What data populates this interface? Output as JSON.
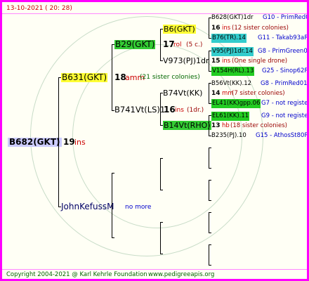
{
  "header": {
    "date": "13-10-2021 ( 20: 28)"
  },
  "root": {
    "name": "B682(GKT)",
    "count": "19",
    "unit": "ins"
  },
  "father": {
    "name": "B631(GKT)",
    "count": "18",
    "unit": "amm",
    "note": "(21 sister colonies)"
  },
  "mother": {
    "name": "JohnKefussM",
    "note": "no more"
  },
  "ff": {
    "name": "B29(GKT)",
    "count": "17",
    "unit": "rol",
    "note": "(5 c.)"
  },
  "fm": {
    "name": "B741Vt(LS)1",
    "count": "16",
    "unit": "ins",
    "note": "(1dr.)"
  },
  "fff": {
    "name": "B6(GKT)"
  },
  "ffm": {
    "name": "V973(PJ)1dr"
  },
  "fmf": {
    "name": "B74Vt(KK)"
  },
  "fmm": {
    "name": "B14Vt(RHO)"
  },
  "rows": [
    {
      "name": "B628(GKT)1dr",
      "gen": "G10 - PrimRed01"
    },
    {
      "count": "16",
      "unit": "ins",
      "note": "(12 sister colonies)"
    },
    {
      "name": "B76(TR).14",
      "gen": "G11 - Takab93aR"
    },
    {
      "name": "V95(PJ)1dr.14",
      "gen": "G8 - PrimGreen00"
    },
    {
      "count": "15",
      "unit": "ins",
      "note": "(One single drone)"
    },
    {
      "name": "V154H(RL).13",
      "gen": "G25 - Sinop62R"
    },
    {
      "name": "B56Vt(KK).12",
      "gen": "G8 - PrimRed01"
    },
    {
      "count": "14",
      "unit": "mm",
      "note": "(7 sister colonies)"
    },
    {
      "name": "EL41(KK)gpp.06",
      "gen": "G7 - not registe"
    },
    {
      "name": "EL61(KK).11",
      "gen": "G9 - not registe"
    },
    {
      "count": "13",
      "unit": "hb",
      "note": "(18 sister colonies)"
    },
    {
      "name": "B235(PJ).10",
      "gen": "G15 - AthosSt80R"
    }
  ],
  "footer": {
    "copyright": "Copyright 2004-2021 @ Karl Kehrle Foundation",
    "url": "www.pedigreeapis.org"
  },
  "colors": {
    "frame": "#ff00ff",
    "yellow": "#ffff33",
    "green": "#33cc33",
    "cyan": "#33cccc",
    "blue": "#0000cc",
    "red": "#cc0000"
  }
}
